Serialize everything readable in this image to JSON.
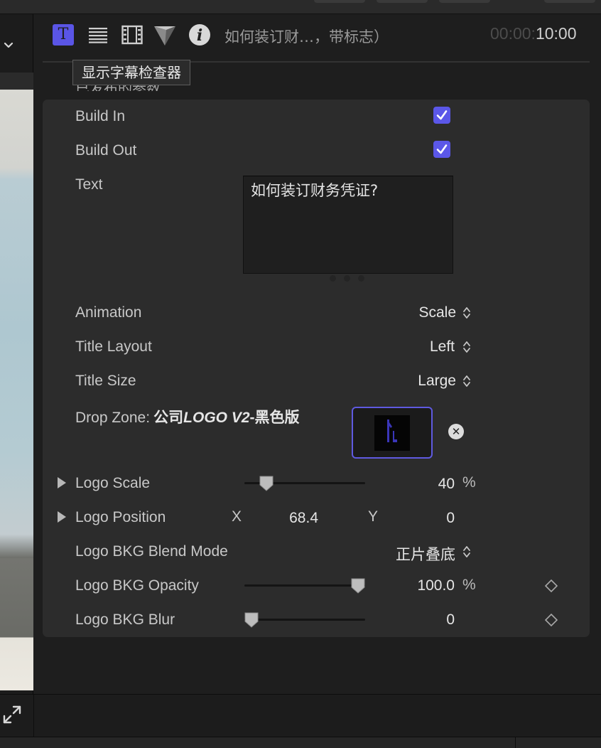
{
  "header": {
    "title": "如何装订财…，带标志）",
    "timecode_dim": "00:00:",
    "timecode_bright": "10:00",
    "icons": [
      "title-inspector-icon",
      "text-inspector-icon",
      "video-inspector-icon",
      "generator-inspector-icon",
      "info-inspector-icon"
    ]
  },
  "tooltip": "显示字幕检查器",
  "section_header_clipped": "已发布的参数",
  "params": {
    "build_in": {
      "label": "Build In",
      "checked": true
    },
    "build_out": {
      "label": "Build Out",
      "checked": true
    },
    "text": {
      "label": "Text",
      "value": "如何装订财务凭证?"
    },
    "animation": {
      "label": "Animation",
      "value": "Scale"
    },
    "title_layout": {
      "label": "Title Layout",
      "value": "Left"
    },
    "title_size": {
      "label": "Title Size",
      "value": "Large"
    },
    "drop_zone": {
      "label": "Drop Zone:",
      "value": "公司",
      "value_italic": "LOGO V2",
      "value_suffix": "-黑色版"
    },
    "logo_scale": {
      "label": "Logo Scale",
      "value": "40",
      "unit": "%",
      "slider_fraction": 0.14
    },
    "logo_position": {
      "label": "Logo Position",
      "x_label": "X",
      "x_value": "68.4",
      "y_label": "Y",
      "y_value": "0"
    },
    "logo_bkg_blend_mode": {
      "label": "Logo BKG Blend Mode",
      "value": "正片叠底"
    },
    "logo_bkg_opacity": {
      "label": "Logo BKG Opacity",
      "value": "100.0",
      "unit": "%",
      "slider_fraction": 1.0
    },
    "logo_bkg_blur": {
      "label": "Logo BKG Blur",
      "value": "0",
      "slider_fraction": 0.0
    }
  },
  "colors": {
    "accent": "#5b57e8",
    "panel": "#2c2c2c",
    "background": "#1e1e1e"
  }
}
